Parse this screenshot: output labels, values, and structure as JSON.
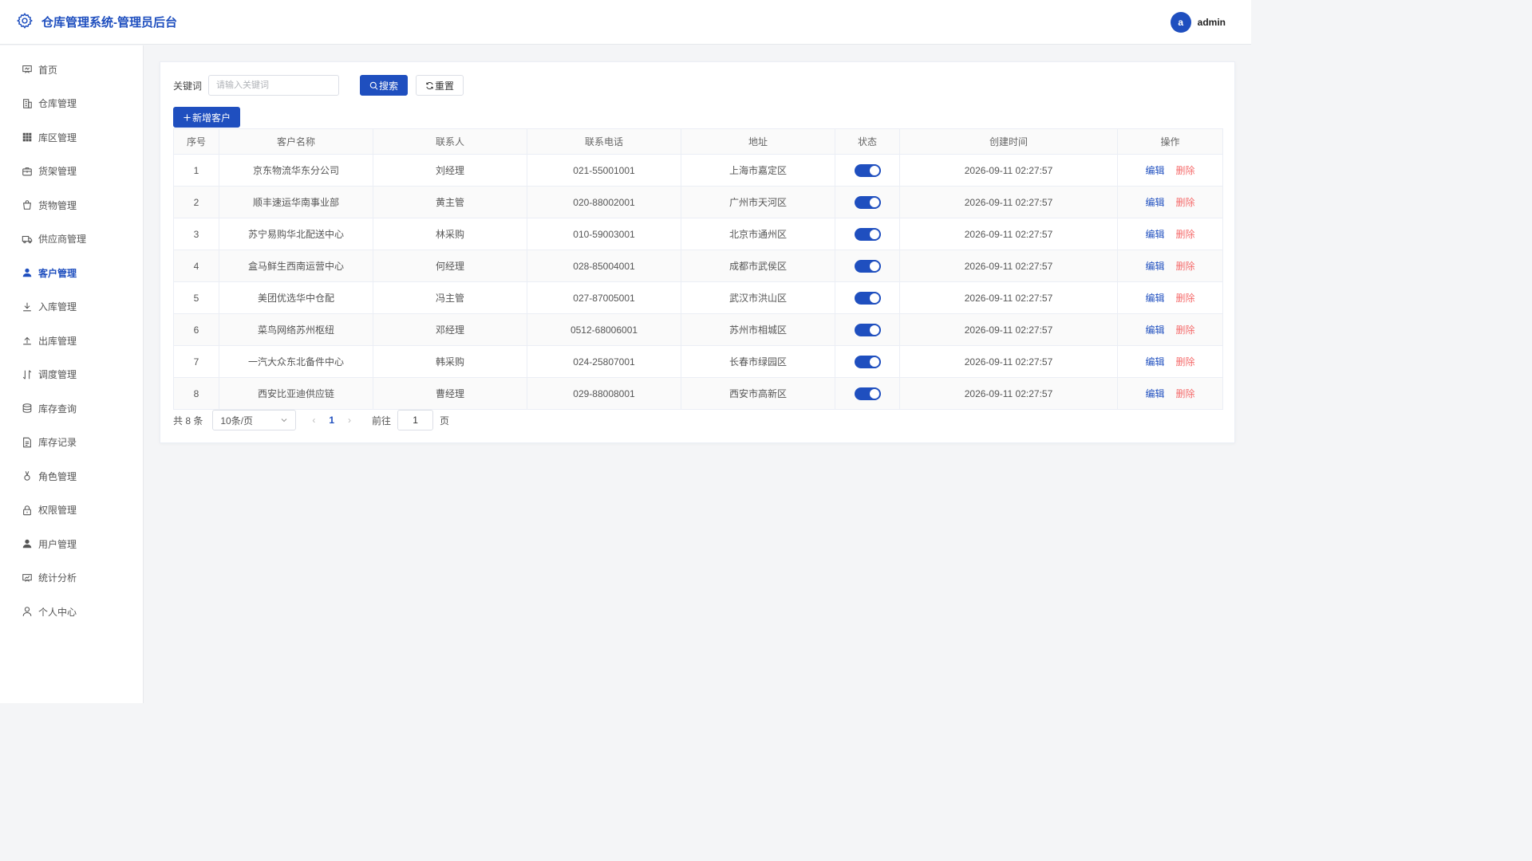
{
  "header": {
    "title": "仓库管理系统-管理员后台",
    "avatar_letter": "a",
    "username": "admin",
    "brand_color": "#1f4fbf"
  },
  "sidebar": {
    "items": [
      {
        "label": "首页",
        "icon": "dashboard-icon",
        "active": false
      },
      {
        "label": "仓库管理",
        "icon": "building-icon",
        "active": false
      },
      {
        "label": "库区管理",
        "icon": "grid-icon",
        "active": false
      },
      {
        "label": "货架管理",
        "icon": "briefcase-icon",
        "active": false
      },
      {
        "label": "货物管理",
        "icon": "shopping-bag-icon",
        "active": false
      },
      {
        "label": "供应商管理",
        "icon": "truck-icon",
        "active": false
      },
      {
        "label": "客户管理",
        "icon": "user-filled-icon",
        "active": true
      },
      {
        "label": "入库管理",
        "icon": "download-icon",
        "active": false
      },
      {
        "label": "出库管理",
        "icon": "upload-icon",
        "active": false
      },
      {
        "label": "调度管理",
        "icon": "sort-icon",
        "active": false
      },
      {
        "label": "库存查询",
        "icon": "database-icon",
        "active": false
      },
      {
        "label": "库存记录",
        "icon": "document-icon",
        "active": false
      },
      {
        "label": "角色管理",
        "icon": "medal-icon",
        "active": false
      },
      {
        "label": "权限管理",
        "icon": "lock-icon",
        "active": false
      },
      {
        "label": "用户管理",
        "icon": "avatar-icon",
        "active": false
      },
      {
        "label": "统计分析",
        "icon": "chart-board-icon",
        "active": false
      },
      {
        "label": "个人中心",
        "icon": "user-outline-icon",
        "active": false
      }
    ]
  },
  "search": {
    "label": "关键词",
    "placeholder": "请输入关键词",
    "value": "",
    "search_button": "搜索",
    "reset_button": "重置"
  },
  "actions": {
    "add_button": "新增客户"
  },
  "table": {
    "columns": [
      "序号",
      "客户名称",
      "联系人",
      "联系电话",
      "地址",
      "状态",
      "创建时间",
      "操作"
    ],
    "rows": [
      {
        "index": "1",
        "name": "京东物流华东分公司",
        "contact": "刘经理",
        "phone": "021-55001001",
        "address": "上海市嘉定区",
        "status": true,
        "created": "2026-09-11 02:27:57"
      },
      {
        "index": "2",
        "name": "顺丰速运华南事业部",
        "contact": "黄主管",
        "phone": "020-88002001",
        "address": "广州市天河区",
        "status": true,
        "created": "2026-09-11 02:27:57"
      },
      {
        "index": "3",
        "name": "苏宁易购华北配送中心",
        "contact": "林采购",
        "phone": "010-59003001",
        "address": "北京市通州区",
        "status": true,
        "created": "2026-09-11 02:27:57"
      },
      {
        "index": "4",
        "name": "盒马鲜生西南运营中心",
        "contact": "何经理",
        "phone": "028-85004001",
        "address": "成都市武侯区",
        "status": true,
        "created": "2026-09-11 02:27:57"
      },
      {
        "index": "5",
        "name": "美团优选华中仓配",
        "contact": "冯主管",
        "phone": "027-87005001",
        "address": "武汉市洪山区",
        "status": true,
        "created": "2026-09-11 02:27:57"
      },
      {
        "index": "6",
        "name": "菜鸟网络苏州枢纽",
        "contact": "邓经理",
        "phone": "0512-68006001",
        "address": "苏州市相城区",
        "status": true,
        "created": "2026-09-11 02:27:57"
      },
      {
        "index": "7",
        "name": "一汽大众东北备件中心",
        "contact": "韩采购",
        "phone": "024-25807001",
        "address": "长春市绿园区",
        "status": true,
        "created": "2026-09-11 02:27:57"
      },
      {
        "index": "8",
        "name": "西安比亚迪供应链",
        "contact": "曹经理",
        "phone": "029-88008001",
        "address": "西安市高新区",
        "status": true,
        "created": "2026-09-11 02:27:57"
      }
    ],
    "edit_label": "编辑",
    "delete_label": "删除"
  },
  "pagination": {
    "total_text": "共 8 条",
    "page_size": "10条/页",
    "current_page": "1",
    "goto_label": "前往",
    "goto_value": "1",
    "page_suffix": "页"
  }
}
